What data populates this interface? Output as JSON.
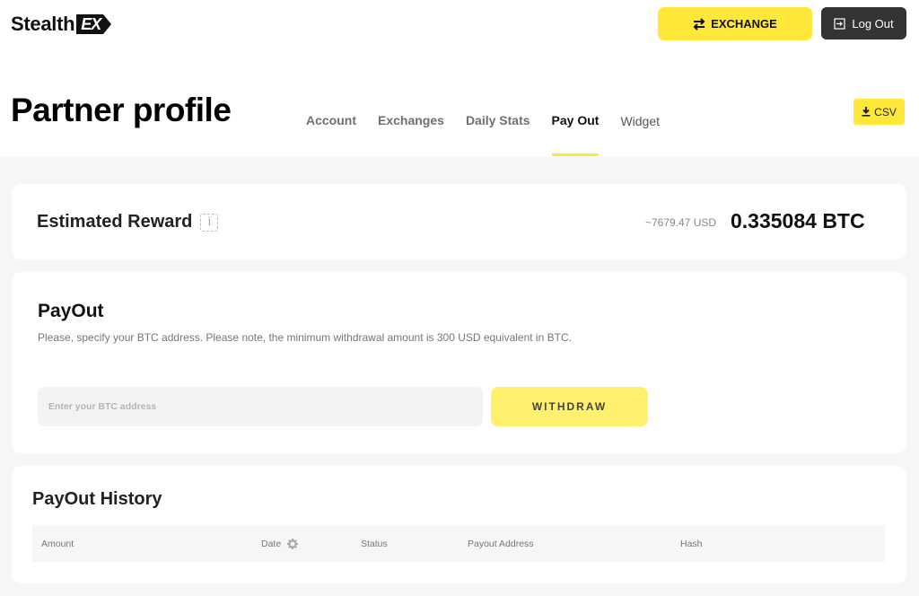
{
  "brand": {
    "name": "Stealth",
    "badge": "EX"
  },
  "header": {
    "exchange_label": "EXCHANGE",
    "exchange_icon": "swap-arrows-icon",
    "logout_label": "Log Out",
    "logout_icon": "logout-icon"
  },
  "page": {
    "title": "Partner profile",
    "tabs": [
      {
        "label": "Account",
        "active": false
      },
      {
        "label": "Exchanges",
        "active": false
      },
      {
        "label": "Daily Stats",
        "active": false
      },
      {
        "label": "Pay Out",
        "active": true
      },
      {
        "label": "Widget",
        "active": false
      }
    ],
    "csv_label": "CSV",
    "csv_icon": "download-icon"
  },
  "reward": {
    "title": "Estimated Reward",
    "info_icon": "i",
    "usd": "~7679.47 USD",
    "btc": "0.335084 BTC"
  },
  "payout": {
    "title": "PayOut",
    "description": "Please, specify your BTC address. Please note, the minimum withdrawal amount is 300 USD equivalent in BTC.",
    "address_value": "",
    "address_placeholder": "Enter your BTC address",
    "withdraw_label": "WITHDRAW"
  },
  "history": {
    "title": "PayOut History",
    "columns": [
      "Amount",
      "Date",
      "Status",
      "Payout Address",
      "Hash"
    ],
    "rows": []
  },
  "colors": {
    "accent": "#ffe83a",
    "withdraw": "#fff06e",
    "dark_button": "#333333",
    "page_bg": "#f6f6f6"
  }
}
